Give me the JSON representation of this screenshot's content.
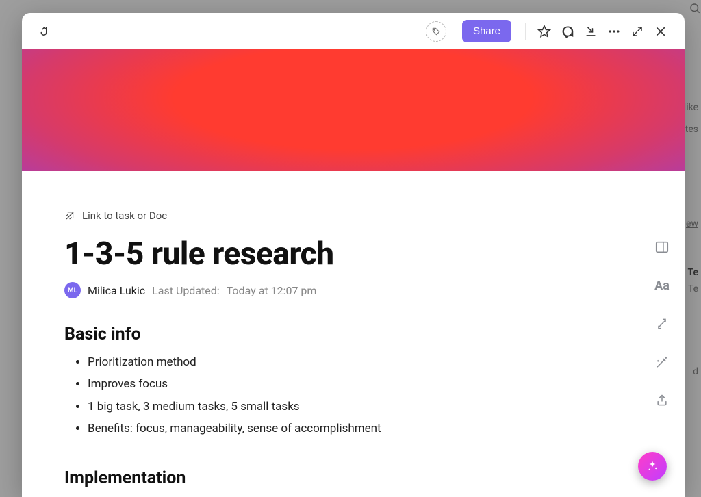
{
  "toolbar": {
    "share_label": "Share"
  },
  "link_row": {
    "label": "Link to task or Doc"
  },
  "doc": {
    "title": "1-3-5 rule research",
    "author_initials": "ML",
    "author_name": "Milica Lukic",
    "updated_label": "Last Updated:",
    "updated_value": "Today at 12:07 pm"
  },
  "sections": {
    "basic_info": {
      "heading": "Basic info",
      "items": [
        "Prioritization method",
        "Improves focus",
        "1 big task, 3 medium tasks, 5 small tasks",
        "Benefits: focus, manageability, sense of accomplishment"
      ]
    },
    "implementation": {
      "heading": "Implementation"
    }
  },
  "background_fragments": {
    "like": "like",
    "tes": "tes",
    "ew": "ew",
    "te": "Te",
    "tea": "Te",
    "d": "d"
  }
}
